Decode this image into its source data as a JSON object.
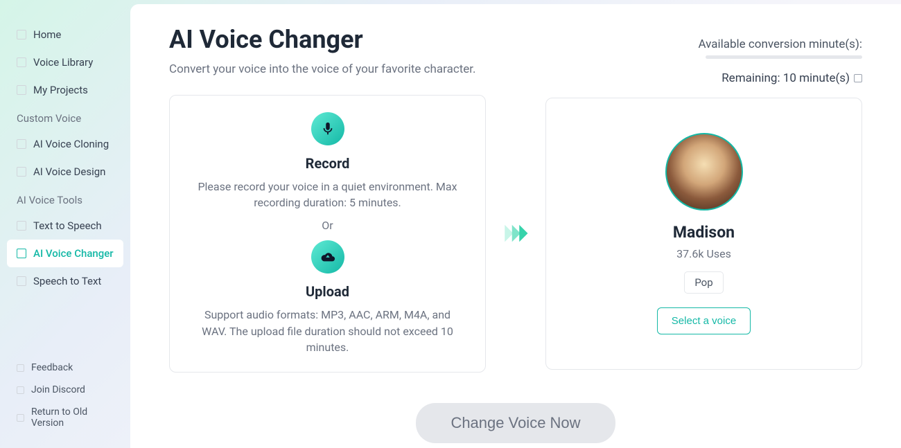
{
  "sidebar": {
    "main_items": [
      {
        "label": "Home"
      },
      {
        "label": "Voice Library"
      },
      {
        "label": "My Projects"
      }
    ],
    "section1_title": "Custom Voice",
    "section1_items": [
      {
        "label": "AI Voice Cloning"
      },
      {
        "label": "AI Voice Design"
      }
    ],
    "section2_title": "AI Voice Tools",
    "section2_items": [
      {
        "label": "Text to Speech"
      },
      {
        "label": "AI Voice Changer",
        "active": true
      },
      {
        "label": "Speech to Text"
      }
    ],
    "bottom_items": [
      {
        "label": "Feedback"
      },
      {
        "label": "Join Discord"
      },
      {
        "label": "Return to Old Version"
      }
    ]
  },
  "header": {
    "title": "AI Voice Changer",
    "subtitle": "Convert your voice into the voice of your favorite character."
  },
  "credits": {
    "label": "Available conversion minute(s):",
    "remaining": "Remaining: 10 minute(s)"
  },
  "record": {
    "heading": "Record",
    "text": "Please record your voice in a quiet environment. Max recording duration: 5 minutes."
  },
  "or_text": "Or",
  "upload": {
    "heading": "Upload",
    "text": "Support audio formats: MP3, AAC, ARM, M4A, and WAV. The upload file duration should not exceed 10 minutes."
  },
  "voice": {
    "name": "Madison",
    "uses": "37.6k Uses",
    "tag": "Pop",
    "select_label": "Select a voice"
  },
  "cta_label": "Change Voice Now"
}
